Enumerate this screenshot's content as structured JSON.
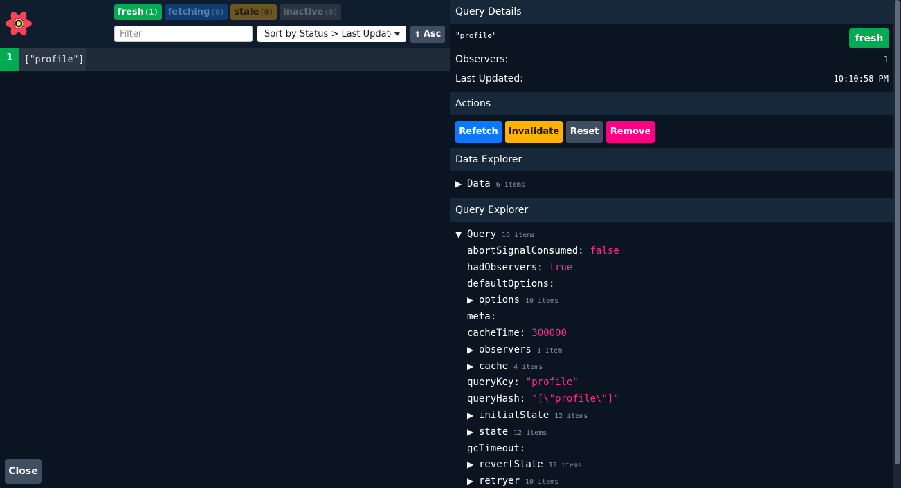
{
  "status_badges": [
    {
      "label": "fresh",
      "count": "(1)"
    },
    {
      "label": "fetching",
      "count": "(0)"
    },
    {
      "label": "stale",
      "count": "(0)"
    },
    {
      "label": "inactive",
      "count": "(0)"
    }
  ],
  "filter": {
    "placeholder": "Filter",
    "value": ""
  },
  "sort": {
    "value": "Sort by Status > Last Updated"
  },
  "sort_direction": {
    "arrow": "⬆",
    "label": "Asc"
  },
  "queries": [
    {
      "observers": "1",
      "key": "[\"profile\"]"
    }
  ],
  "close_label": "Close",
  "details": {
    "header": "Query Details",
    "query_hash": "\"profile\"",
    "status": "fresh",
    "observers_label": "Observers:",
    "observers_value": "1",
    "last_updated_label": "Last Updated:",
    "last_updated_value": "10:10:58 PM"
  },
  "actions": {
    "header": "Actions",
    "refetch": "Refetch",
    "invalidate": "Invalidate",
    "reset": "Reset",
    "remove": "Remove"
  },
  "data_explorer": {
    "header": "Data Explorer",
    "root_label": "Data",
    "root_items": "6 items"
  },
  "query_explorer": {
    "header": "Query Explorer",
    "root_label": "Query",
    "root_items": "16 items",
    "entries": [
      {
        "key": "abortSignalConsumed:",
        "value": "false"
      },
      {
        "key": "hadObservers:",
        "value": "true"
      },
      {
        "key": "defaultOptions:",
        "value": ""
      },
      {
        "key": "options",
        "items": "10 items",
        "expandable": true
      },
      {
        "key": "meta:",
        "value": ""
      },
      {
        "key": "cacheTime:",
        "value": "300000"
      },
      {
        "key": "observers",
        "items": "1 item",
        "expandable": true
      },
      {
        "key": "cache",
        "items": "4 items",
        "expandable": true
      },
      {
        "key": "queryKey:",
        "value": "\"profile\""
      },
      {
        "key": "queryHash:",
        "value": "\"[\\\"profile\\\"]\""
      },
      {
        "key": "initialState",
        "items": "12 items",
        "expandable": true
      },
      {
        "key": "state",
        "items": "12 items",
        "expandable": true
      },
      {
        "key": "gcTimeout:",
        "value": ""
      },
      {
        "key": "revertState",
        "items": "12 items",
        "expandable": true
      },
      {
        "key": "retryer",
        "items": "10 items",
        "expandable": true
      }
    ]
  },
  "colors": {
    "fresh": "#00ab52",
    "refetch": "#0b78ff",
    "invalidate": "#ffb200",
    "remove": "#ff0085",
    "value_text": "#ff2d8e",
    "header_bg": "#18283b",
    "page_bg": "#0b1521"
  },
  "icons": {
    "logo": "react-query-logo-icon",
    "sort_caret": "chevron-down-icon",
    "collapsed": "triangle-right-icon",
    "expanded": "triangle-down-icon"
  }
}
